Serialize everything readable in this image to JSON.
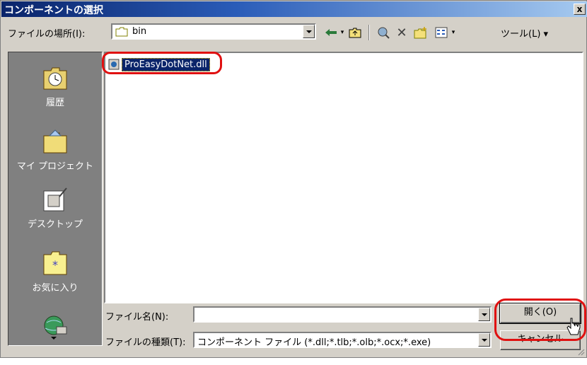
{
  "window": {
    "title": "コンポーネントの選択",
    "close": "x"
  },
  "lookin": {
    "label": "ファイルの場所(I):",
    "value": "bin"
  },
  "toolbar": {
    "tools_label": "ツール(L) ▾"
  },
  "places": [
    {
      "label": "履歴",
      "icon": "history-icon"
    },
    {
      "label": "マイ プロジェクト",
      "icon": "my-projects-icon"
    },
    {
      "label": "デスクトップ",
      "icon": "desktop-icon"
    },
    {
      "label": "お気に入り",
      "icon": "favorites-icon"
    },
    {
      "label": "",
      "icon": "network-places-icon"
    }
  ],
  "files": [
    {
      "name": "ProEasyDotNet.dll",
      "selected": true,
      "icon": "dll-file-icon"
    }
  ],
  "filename": {
    "label": "ファイル名(N):",
    "value": ""
  },
  "filetype": {
    "label": "ファイルの種類(T):",
    "value": "コンポーネント ファイル (*.dll;*.tlb;*.olb;*.ocx;*.exe)"
  },
  "buttons": {
    "open": "開く(O)",
    "cancel": "キャンセル"
  },
  "colors": {
    "highlight": "#e01010",
    "selection": "#0a246a",
    "face": "#d4d0c8"
  }
}
